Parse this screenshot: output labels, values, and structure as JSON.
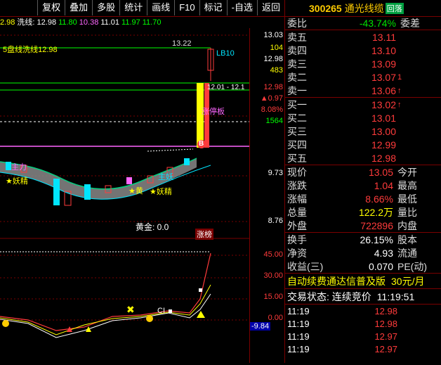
{
  "toolbar": {
    "buttons": [
      "复权",
      "叠加",
      "多股",
      "统计",
      "画线",
      "F10",
      "标记",
      "-自选",
      "返回"
    ]
  },
  "indicator_line": {
    "items": [
      {
        "text": "2.98",
        "color": "#ffff00"
      },
      {
        "text": "洗线: 12.98",
        "color": "#ffffff"
      },
      {
        "text": "11.80",
        "color": "#00ff00"
      },
      {
        "text": "10.38",
        "color": "#ff66ff"
      },
      {
        "text": "11.01",
        "color": "#ffffff"
      },
      {
        "text": "11.97",
        "color": "#00ff00"
      },
      {
        "text": "11.70",
        "color": "#00ff00"
      }
    ]
  },
  "chart": {
    "labels": {
      "washline_label": "5盘线洗线12.98",
      "high_price": "13.22",
      "lb_tag": "LB10",
      "price_ticker": "12.01 - 12.1",
      "limit_up_label": "涨停板",
      "huang_label": "黄金: 0.0",
      "zhangting_badge": "涨榜",
      "zhuli_label": "主力",
      "b_marker": "B",
      "yaojing_1": "★妖精",
      "yaojing_2": "★妖精",
      "huang_marker": "★黄",
      "zhuyao_label": "主妖",
      "ci_label": "CI"
    },
    "colors": {
      "up": "#ff3b3b",
      "down": "#00e5ff",
      "ma_white": "#ffffff",
      "ma_yellow": "#ffff00",
      "ma_purple": "#ff66ff"
    }
  },
  "price_axis": {
    "values": [
      {
        "text": "13.03",
        "color": "#ffffff"
      },
      {
        "text": "104",
        "color": "#ffff00"
      },
      {
        "text": "12.98",
        "color": "#ffffff"
      },
      {
        "text": "483",
        "color": "#ffff00"
      },
      {
        "text": "12.98",
        "color": "#ff3b3b"
      },
      {
        "text": "▲0.97",
        "color": "#ff3b3b"
      },
      {
        "text": "8.08%",
        "color": "#ff3b3b"
      },
      {
        "text": "1564",
        "color": "#00ff00"
      },
      {
        "text": "9.73",
        "color": "#ffffff"
      },
      {
        "text": "8.76",
        "color": "#ffffff"
      },
      {
        "text": "45.00",
        "color": "#ff3b3b"
      },
      {
        "text": "30.00",
        "color": "#ff3b3b"
      },
      {
        "text": "15.00",
        "color": "#ff3b3b"
      },
      {
        "text": "0.00",
        "color": "#ff3b3b"
      },
      {
        "text": "-9.84",
        "color": "#ffffff"
      }
    ]
  },
  "quote": {
    "code": "300265",
    "name": "通光线缆",
    "tag": "回落",
    "weibi_label": "委比",
    "weibi_value": "-43.74%",
    "weicha_label": "委差",
    "asks": [
      {
        "label": "卖五",
        "price": "13.11",
        "vol": ""
      },
      {
        "label": "卖四",
        "price": "13.10",
        "vol": ""
      },
      {
        "label": "卖三",
        "price": "13.09",
        "vol": ""
      },
      {
        "label": "卖二",
        "price": "13.07",
        "vol": "1"
      },
      {
        "label": "卖一",
        "price": "13.06",
        "vol": "↑"
      }
    ],
    "bids": [
      {
        "label": "买一",
        "price": "13.02",
        "vol": "↑"
      },
      {
        "label": "买二",
        "price": "13.01",
        "vol": ""
      },
      {
        "label": "买三",
        "price": "13.00",
        "vol": ""
      },
      {
        "label": "买四",
        "price": "12.99",
        "vol": ""
      },
      {
        "label": "买五",
        "price": "12.98",
        "vol": ""
      }
    ],
    "stats": [
      {
        "l1": "现价",
        "v": "13.05",
        "l2": "今开",
        "color": "#ff3b3b"
      },
      {
        "l1": "涨跌",
        "v": "1.04",
        "l2": "最高",
        "color": "#ff3b3b"
      },
      {
        "l1": "涨幅",
        "v": "8.66%",
        "l2": "最低",
        "color": "#ff3b3b"
      },
      {
        "l1": "总量",
        "v": "122.2万",
        "l2": "量比",
        "color": "#ffff00"
      },
      {
        "l1": "外盘",
        "v": "722896",
        "l2": "内盘",
        "color": "#ff3b3b"
      }
    ],
    "stats2": [
      {
        "l1": "换手",
        "v": "26.15%",
        "l2": "股本",
        "color": "#ffffff"
      },
      {
        "l1": "净资",
        "v": "4.93",
        "l2": "流通",
        "color": "#ffffff"
      },
      {
        "l1": "收益(三)",
        "v": "0.070",
        "l2": "PE(动)",
        "color": "#ffffff"
      }
    ],
    "promo_text": "自动续费通达信普及版",
    "promo_price": "30元/月",
    "status_text": "交易状态: 连续竞价",
    "status_time": "11:19:51",
    "ticks": [
      {
        "time": "11:19",
        "price": "12.98"
      },
      {
        "time": "11:19",
        "price": "12.98"
      },
      {
        "time": "11:19",
        "price": "12.97"
      },
      {
        "time": "11:19",
        "price": "12.97"
      }
    ]
  }
}
